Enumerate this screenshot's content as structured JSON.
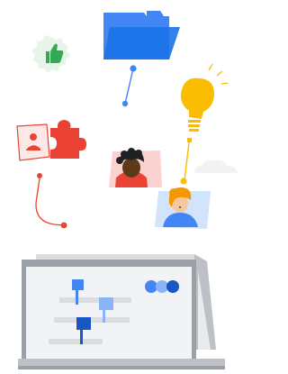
{
  "illustration": {
    "palette": {
      "blue": "#4285F4",
      "blue_dark": "#1a56c4",
      "blue_light": "#8AB4F8",
      "blue_pale": "#d2e3fc",
      "red": "#EA4335",
      "red_pale": "#fce8e6",
      "yellow": "#FBBC04",
      "green": "#34A853",
      "green_pale": "#e6f4ea",
      "grey_frame": "#9aa0a6",
      "grey_light": "#dadce0",
      "grey_bar": "#bdc1c6"
    },
    "elements": [
      "folder-icon",
      "thumbs-up-badge-icon",
      "lightbulb-icon",
      "puzzle-icon",
      "person-card-icon",
      "avatar-man",
      "avatar-woman",
      "cloud-icon",
      "laptop-with-timeline"
    ]
  }
}
